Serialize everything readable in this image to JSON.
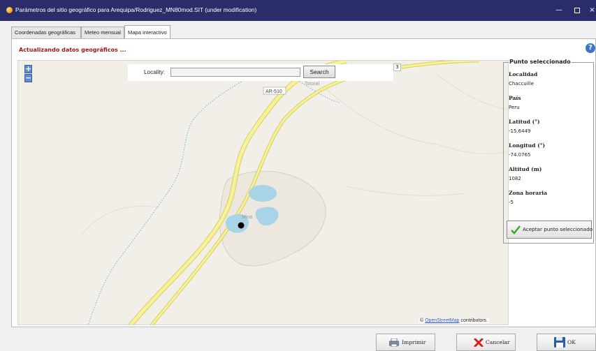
{
  "window": {
    "title": "Parámetros del sitio geográfico para Arequipa/Rodriguez_MN80mod.SIT (under modification)",
    "min_glyph": "—",
    "close_glyph": "×"
  },
  "tabs": [
    {
      "label": "Coordenadas geográficas"
    },
    {
      "label": "Meteo mensual"
    },
    {
      "label": "Mapa interactivo",
      "active": true
    }
  ],
  "status": "Actualizando datos geográficos ...",
  "help_glyph": "?",
  "map": {
    "zoom_in": "+",
    "zoom_out": "−",
    "locality_label": "Locality:",
    "locality_value": "",
    "search_label": "Search",
    "road_label": "AR-510",
    "place_label_1": "Totoral",
    "place_label_2": "Mina",
    "corner_label": "3",
    "attribution_prefix": "© ",
    "attribution_link": "OpenStreetMap",
    "attribution_suffix": " contributors."
  },
  "selected_point": {
    "legend": "Punto seleccionado",
    "fields": [
      {
        "label": "Localidad",
        "value": "Chaccuille"
      },
      {
        "label": "País",
        "value": "Peru"
      },
      {
        "label": "Latitud (°)",
        "value": "-15.6449"
      },
      {
        "label": "Longitud (°)",
        "value": "-74.0765"
      },
      {
        "label": "Altitud (m)",
        "value": "1082"
      },
      {
        "label": "Zona horaria",
        "value": "-5"
      }
    ],
    "accept_label": "Aceptar punto seleccionado"
  },
  "buttons": {
    "print_label": "Imprimir",
    "cancel_label": "Cancelar",
    "ok_label": "OK"
  },
  "colors": {
    "titlebar": "#2b2d6b",
    "status_text": "#a01818",
    "road_fill": "#f6f19a",
    "road_edge": "#d8cf5a",
    "water": "#a9d3e6",
    "path_dots": "#6fb2d6",
    "accent_blue": "#3b74c8"
  },
  "icons": [
    "app-icon",
    "help-icon",
    "zoom-in-icon",
    "zoom-out-icon",
    "map-marker-icon",
    "checkmark-icon",
    "printer-icon",
    "cancel-x-icon",
    "save-disk-icon"
  ]
}
